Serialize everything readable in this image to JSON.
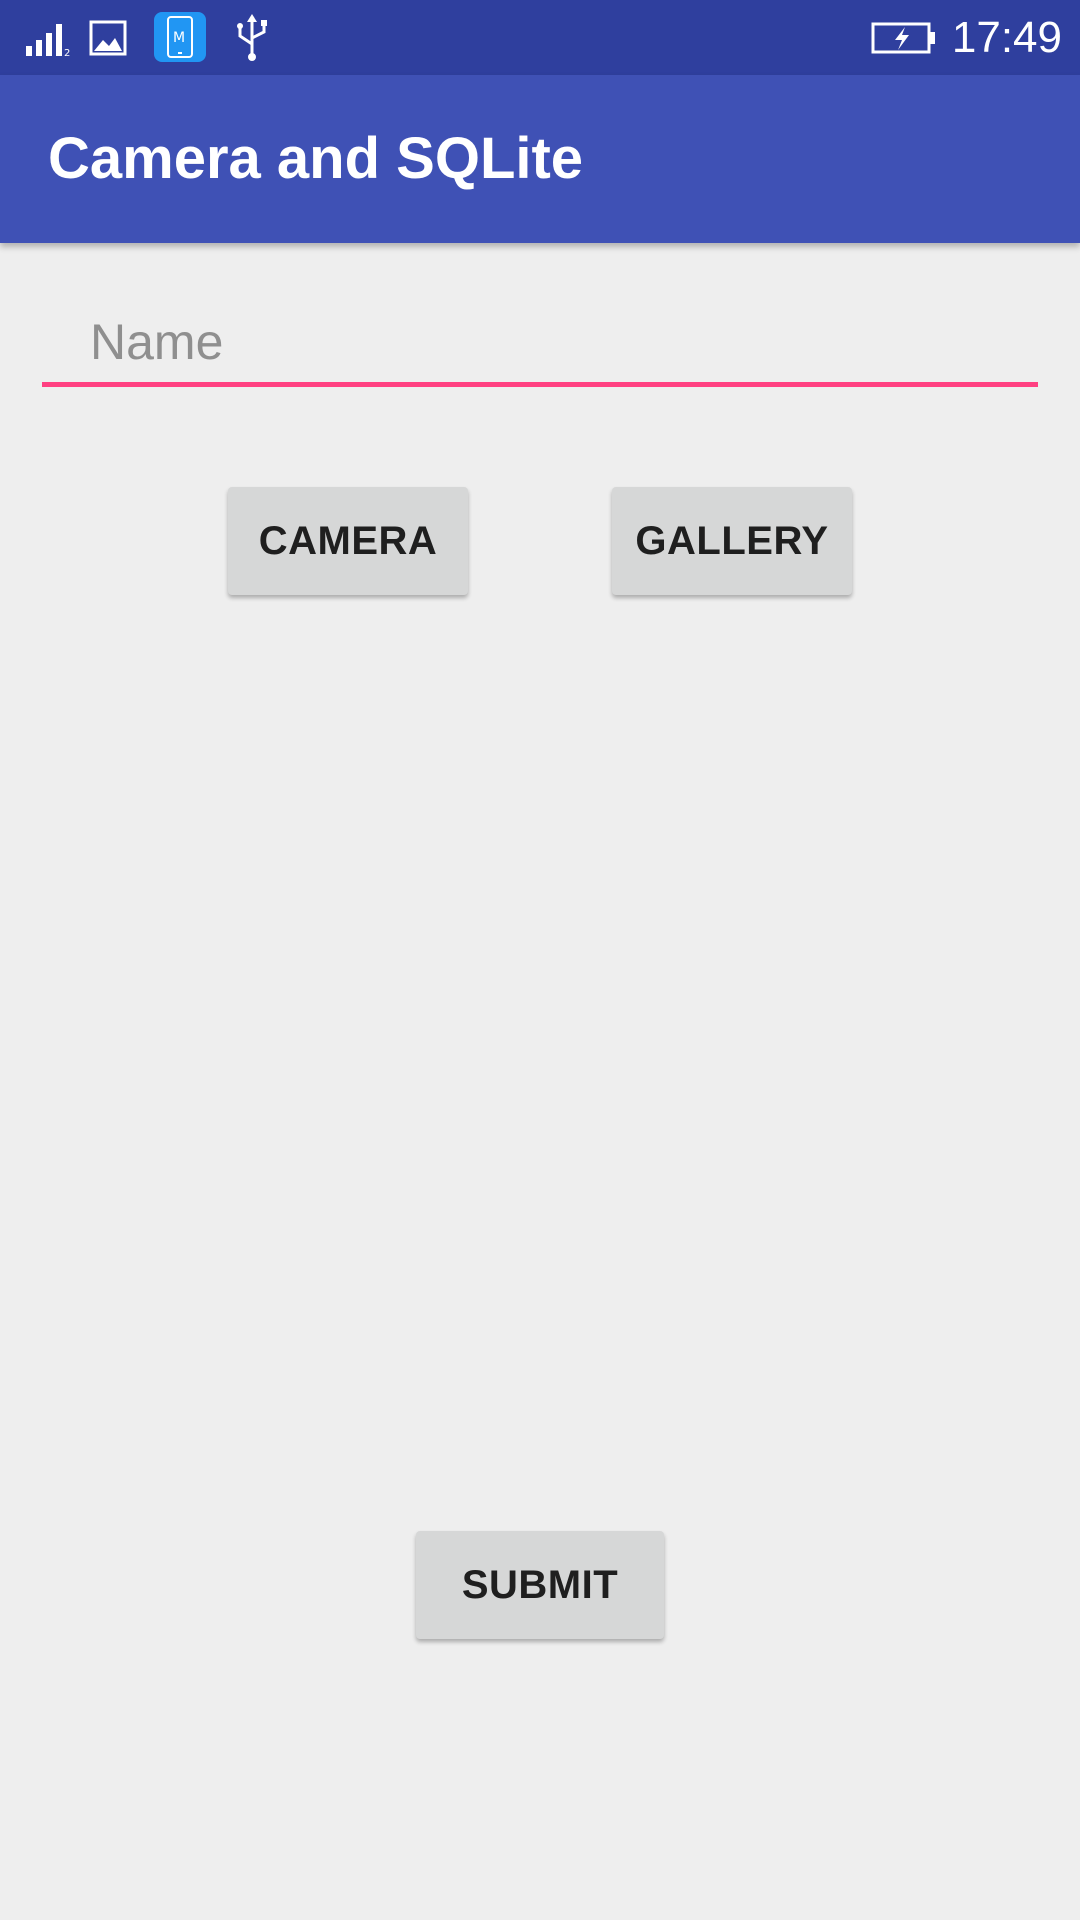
{
  "status_bar": {
    "time": "17:49",
    "icons": [
      "signal-icon",
      "image-notification-icon",
      "app-notification-icon",
      "usb-icon",
      "battery-charging-icon"
    ],
    "color": "#2f3f9e"
  },
  "app_bar": {
    "title": "Camera and SQLite",
    "color": "#3f51b5"
  },
  "form": {
    "name_placeholder": "Name",
    "name_value": "",
    "accent_color": "#ff4081"
  },
  "buttons": {
    "camera_label": "CAMERA",
    "gallery_label": "GALLERY",
    "submit_label": "SUBMIT"
  }
}
